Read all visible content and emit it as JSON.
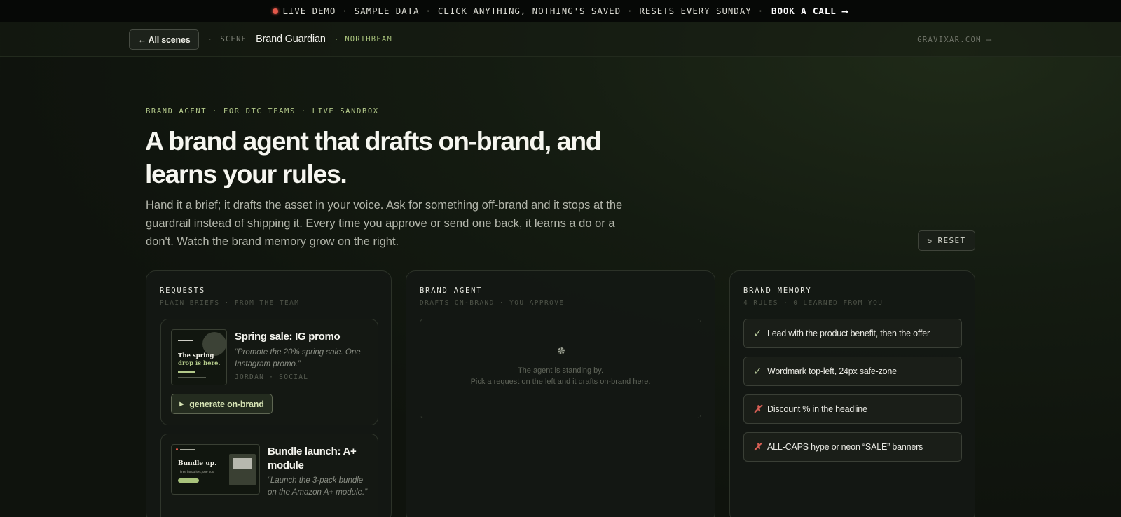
{
  "banner": {
    "live": "LIVE DEMO",
    "sample": "SAMPLE DATA",
    "click": "CLICK ANYTHING, NOTHING'S SAVED",
    "resets": "RESETS EVERY SUNDAY",
    "cta": "BOOK A CALL ⟶",
    "separator": "·"
  },
  "nav": {
    "back_label": "← All scenes",
    "scene_kicker": "SCENE",
    "scene_name": "Brand Guardian",
    "brand_tag": "NORTHBEAM",
    "site_link": "GRAVIXAR.COM ⟶"
  },
  "hero": {
    "kicker": "BRAND AGENT · FOR DTC TEAMS · LIVE SANDBOX",
    "title": "A brand agent that drafts on-brand, and learns your rules.",
    "subtitle": "Hand it a brief; it drafts the asset in your voice. Ask for something off-brand and it stops at the guardrail instead of shipping it. Every time you approve or send one back, it learns a do or a don't. Watch the brand memory grow on the right.",
    "reset_icon": "↻",
    "reset_label": "RESET"
  },
  "requests": {
    "title": "REQUESTS",
    "subtitle": "PLAIN BRIEFS · FROM THE TEAM",
    "items": [
      {
        "title": "Spring sale: IG promo",
        "quote": "“Promote the 20% spring sale. One Instagram promo.”",
        "meta": "JORDAN · SOCIAL",
        "thumb_headline_1": "The spring",
        "thumb_headline_2": "drop is here.",
        "action_label": "generate on-brand",
        "action_icon": "play-icon"
      },
      {
        "title": "Bundle launch: A+ module",
        "quote": "“Launch the 3-pack bundle on the Amazon A+ module.”",
        "thumb_headline": "Bundle up.",
        "thumb_sub": "Three favourites, one box."
      }
    ]
  },
  "agent": {
    "title": "BRAND AGENT",
    "subtitle": "DRAFTS ON-BRAND · YOU APPROVE",
    "empty_line1": "The agent is standing by.",
    "empty_line2": "Pick a request on the left and it drafts on-brand here."
  },
  "memory": {
    "title": "BRAND MEMORY",
    "subtitle": "4 RULES · 0 LEARNED FROM YOU",
    "rules": [
      {
        "kind": "do",
        "mark": "✓",
        "text": "Lead with the product benefit, then the offer"
      },
      {
        "kind": "do",
        "mark": "✓",
        "text": "Wordmark top-left, 24px safe-zone"
      },
      {
        "kind": "dont",
        "mark": "✗",
        "text": "Discount % in the headline"
      },
      {
        "kind": "dont",
        "mark": "✗",
        "text": "ALL-CAPS hype or neon “SALE” banners"
      }
    ]
  },
  "colors": {
    "accent": "#b3c98a",
    "live_dot": "#e4584a",
    "dont": "#d75f55",
    "background": "#11160f"
  }
}
